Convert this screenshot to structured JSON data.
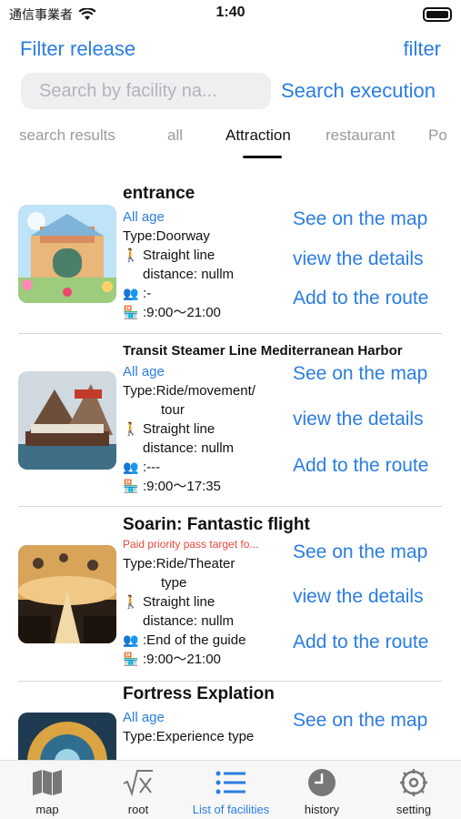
{
  "status": {
    "carrier": "通信事業者",
    "time": "1:40"
  },
  "header": {
    "filter_release": "Filter release",
    "filter": "filter"
  },
  "search": {
    "placeholder": "Search by facility na...",
    "execute": "Search execution"
  },
  "tabs": [
    {
      "label": "search results",
      "active": false
    },
    {
      "label": "all",
      "active": false
    },
    {
      "label": "Attraction",
      "active": true
    },
    {
      "label": "restaurant",
      "active": false
    },
    {
      "label": "Po",
      "active": false
    }
  ],
  "facilities": [
    {
      "name": "entrance",
      "age": "All age",
      "type": "Type:Doorway",
      "distance_line1": "Straight line",
      "distance_line2": "distance: nullm",
      "wait": ":-",
      "hours": ":9:00～21:00",
      "actions": {
        "map": "See on the map",
        "details": "view the details",
        "route": "Add to the route"
      }
    },
    {
      "name": "Transit Steamer Line Mediterranean Harbor",
      "age": "All age",
      "type_line1": "Type:Ride/movement/",
      "type_line2": "tour",
      "distance_line1": "Straight line",
      "distance_line2": "distance: nullm",
      "wait": ":---",
      "hours": ":9:00～17:35",
      "actions": {
        "map": "See on the map",
        "details": "view the details",
        "route": "Add to the route"
      }
    },
    {
      "name": "Soarin: Fantastic flight",
      "age": "Paid priority pass target fo...",
      "type_line1": "Type:Ride/Theater",
      "type_line2": "type",
      "distance_line1": "Straight line",
      "distance_line2": "distance: nullm",
      "wait": ":End of the guide",
      "hours": ":9:00～21:00",
      "actions": {
        "map": "See on the map",
        "details": "view the details",
        "route": "Add to the route"
      }
    },
    {
      "name": "Fortress Explation",
      "age": "All age",
      "type": "Type:Experience type",
      "actions": {
        "map": "See on the map"
      }
    }
  ],
  "tab_bar": [
    {
      "label": "map",
      "icon": "map-icon"
    },
    {
      "label": "root",
      "icon": "sqrt-icon"
    },
    {
      "label": "List of facilities",
      "icon": "list-icon",
      "active": true
    },
    {
      "label": "history",
      "icon": "clock-icon"
    },
    {
      "label": "setting",
      "icon": "gear-icon"
    }
  ],
  "colors": {
    "accent": "#2a7de1",
    "warning": "#e74a3b"
  }
}
